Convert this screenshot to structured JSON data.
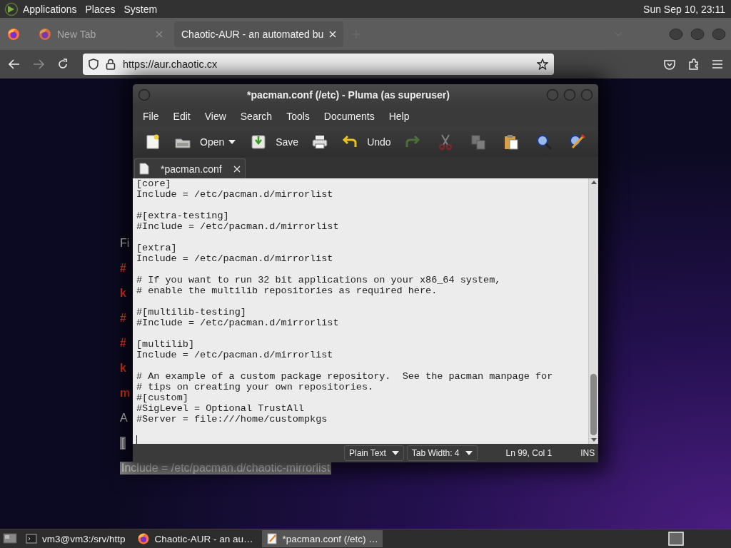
{
  "top_panel": {
    "menus": [
      "Applications",
      "Places",
      "System"
    ],
    "clock": "Sun Sep 10, 23:11"
  },
  "browser": {
    "tabs": [
      {
        "title": "New Tab",
        "selected": false
      },
      {
        "title": "Chaotic-AUR - an automated bu",
        "selected": true
      }
    ],
    "url": "https://aur.chaotic.cx"
  },
  "page": {
    "fragments": [
      {
        "text": "Fi",
        "kind": "plain"
      },
      {
        "text": "#",
        "kind": "accent"
      },
      {
        "text": "k",
        "kind": "accent"
      },
      {
        "text": "#",
        "kind": "accent"
      },
      {
        "text": "#",
        "kind": "accent"
      },
      {
        "text": "k",
        "kind": "accent"
      },
      {
        "text": "m",
        "kind": "accent"
      },
      {
        "text": "A",
        "kind": "plain"
      },
      {
        "text": "[",
        "kind": "selected"
      },
      {
        "text": "Include = /etc/pacman.d/chaotic-mirrorlist",
        "kind": "selected"
      }
    ]
  },
  "editor": {
    "title": "*pacman.conf (/etc) - Pluma (as superuser)",
    "menus": [
      "File",
      "Edit",
      "View",
      "Search",
      "Tools",
      "Documents",
      "Help"
    ],
    "toolbar": [
      {
        "kind": "icon",
        "disabled": false
      },
      {
        "kind": "labeled",
        "label": "Open",
        "disabled": false
      },
      {
        "kind": "dropdown",
        "disabled": false
      },
      {
        "kind": "labeled",
        "label": "Save",
        "disabled": false
      },
      {
        "kind": "icon",
        "disabled": false
      },
      {
        "kind": "labeled",
        "label": "Undo",
        "disabled": false
      },
      {
        "kind": "icon",
        "disabled": true
      },
      {
        "kind": "icon",
        "disabled": true
      },
      {
        "kind": "icon",
        "disabled": true
      },
      {
        "kind": "icon",
        "disabled": false
      },
      {
        "kind": "icon",
        "disabled": false
      },
      {
        "kind": "icon",
        "disabled": false
      }
    ],
    "tabs": [
      {
        "label": "*pacman.conf",
        "selected": true
      }
    ],
    "blocks": [
      [
        "[core]",
        "Include = /etc/pacman.d/mirrorlist"
      ],
      [
        "#[extra-testing]",
        "#Include = /etc/pacman.d/mirrorlist"
      ],
      [
        "[extra]",
        "Include = /etc/pacman.d/mirrorlist"
      ],
      [
        "# If you want to run 32 bit applications on your x86_64 system,",
        "# enable the multilib repositories as required here."
      ],
      [
        "#[multilib-testing]",
        "#Include = /etc/pacman.d/mirrorlist"
      ],
      [
        "[multilib]",
        "Include = /etc/pacman.d/mirrorlist"
      ],
      [
        "# An example of a custom package repository.  See the pacman manpage for",
        "# tips on creating your own repositories.",
        "#[custom]",
        "#SigLevel = Optional TrustAll",
        "#Server = file:///home/custompkgs"
      ]
    ],
    "status": {
      "language": "Plain Text",
      "tab_width": "Tab Width:  4",
      "position": "Ln 99, Col 1",
      "mode": "INS"
    }
  },
  "taskbar": {
    "tasks": [
      {
        "label": "vm3@vm3:/srv/http",
        "selected": false
      },
      {
        "label": "Chaotic-AUR - an au…",
        "selected": false
      },
      {
        "label": "*pacman.conf (/etc) …",
        "selected": true
      }
    ]
  }
}
